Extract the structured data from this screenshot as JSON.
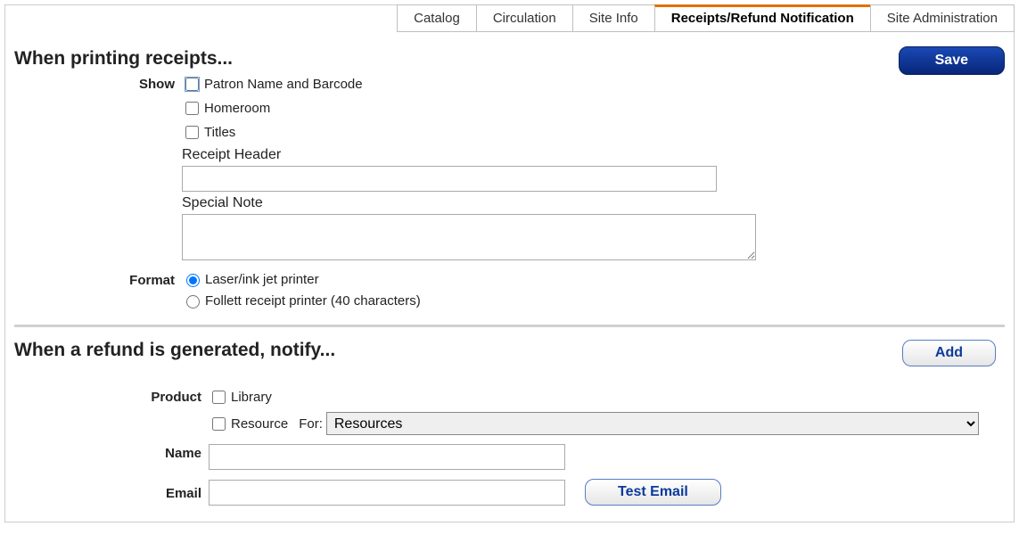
{
  "tabs": {
    "items": [
      {
        "label": "Catalog"
      },
      {
        "label": "Circulation"
      },
      {
        "label": "Site Info"
      },
      {
        "label": "Receipts/Refund Notification"
      },
      {
        "label": "Site Administration"
      }
    ]
  },
  "buttons": {
    "save": "Save",
    "add": "Add",
    "test_email": "Test Email"
  },
  "section1": {
    "title": "When printing receipts...",
    "show_label": "Show",
    "cb_patron": "Patron Name and Barcode",
    "cb_homeroom": "Homeroom",
    "cb_titles": "Titles",
    "receipt_header_label": "Receipt Header",
    "receipt_header_value": "",
    "special_note_label": "Special Note",
    "special_note_value": "",
    "format_label": "Format",
    "radio_laser": "Laser/ink jet printer",
    "radio_follett": "Follett receipt printer (40 characters)"
  },
  "section2": {
    "title": "When a refund is generated, notify...",
    "product_label": "Product",
    "cb_library": "Library",
    "cb_resource": "Resource",
    "for_label": "For:",
    "for_selected": "Resources",
    "name_label": "Name",
    "name_value": "",
    "email_label": "Email",
    "email_value": ""
  }
}
